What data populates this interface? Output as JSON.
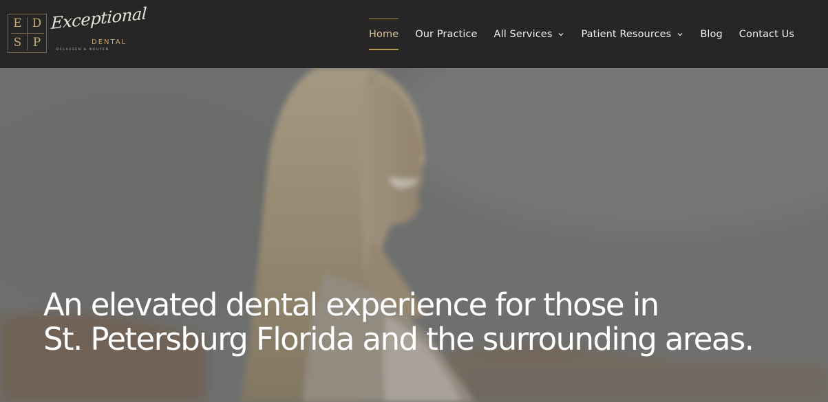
{
  "logo": {
    "monogram": [
      "E",
      "D",
      "S",
      "P"
    ],
    "script": "Exceptional",
    "word": "DENTAL",
    "tagline": "DELASSEN & NGUYEN"
  },
  "nav": {
    "items": [
      {
        "label": "Home",
        "active": true,
        "dropdown": false
      },
      {
        "label": "Our Practice",
        "active": false,
        "dropdown": false
      },
      {
        "label": "All Services",
        "active": false,
        "dropdown": true,
        "icon": "chevron-down-icon"
      },
      {
        "label": "Patient Resources",
        "active": false,
        "dropdown": true,
        "icon": "chevron-down-icon"
      },
      {
        "label": "Blog",
        "active": false,
        "dropdown": false
      },
      {
        "label": "Contact Us",
        "active": false,
        "dropdown": false
      }
    ]
  },
  "hero": {
    "title_line1": "An elevated dental experience for those in",
    "title_line2": "St. Petersburg Florida and the surrounding areas.",
    "image_alt": "smiling woman on beach"
  },
  "colors": {
    "header_bg": "#262626",
    "accent_gold": "#b9975b",
    "nav_text": "#f3f3f3",
    "hero_text": "#ffffff"
  }
}
